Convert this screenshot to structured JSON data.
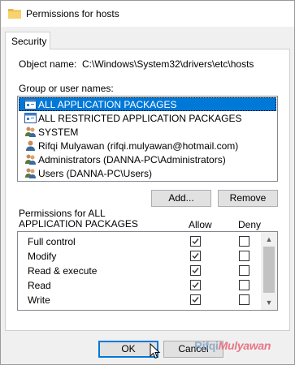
{
  "window": {
    "title": "Permissions for hosts",
    "icon": "folder-icon"
  },
  "tabs": [
    {
      "label": "Security"
    }
  ],
  "object": {
    "label": "Object name:",
    "value": "C:\\Windows\\System32\\drivers\\etc\\hosts"
  },
  "groups": {
    "label": "Group or user names:",
    "items": [
      {
        "label": "ALL APPLICATION PACKAGES",
        "icon": "app-packages-icon",
        "selected": true
      },
      {
        "label": "ALL RESTRICTED APPLICATION PACKAGES",
        "icon": "app-packages-icon",
        "selected": false
      },
      {
        "label": "SYSTEM",
        "icon": "users-group-icon",
        "selected": false
      },
      {
        "label": "Rifqi Mulyawan (rifqi.mulyawan@hotmail.com)",
        "icon": "user-icon",
        "selected": false
      },
      {
        "label": "Administrators (DANNA-PC\\Administrators)",
        "icon": "users-group-icon",
        "selected": false
      },
      {
        "label": "Users (DANNA-PC\\Users)",
        "icon": "users-group-icon",
        "selected": false
      }
    ]
  },
  "buttons": {
    "add": "Add...",
    "remove": "Remove",
    "ok": "OK",
    "cancel": "Cancel"
  },
  "permissions": {
    "label_line1": "Permissions for ALL",
    "label_line2": "APPLICATION PACKAGES",
    "allow_header": "Allow",
    "deny_header": "Deny",
    "rows": [
      {
        "name": "Full control",
        "allow": true,
        "deny": false
      },
      {
        "name": "Modify",
        "allow": true,
        "deny": false
      },
      {
        "name": "Read & execute",
        "allow": true,
        "deny": false
      },
      {
        "name": "Read",
        "allow": true,
        "deny": false
      },
      {
        "name": "Write",
        "allow": true,
        "deny": false
      }
    ]
  },
  "watermark": {
    "part1": "Rifqi",
    "part2": "Mulyawan"
  },
  "colors": {
    "selection": "#0078d7",
    "default_button_border": "#0078d7"
  }
}
